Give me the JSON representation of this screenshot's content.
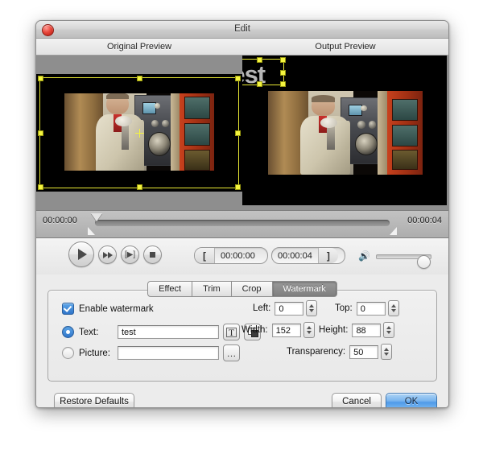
{
  "window": {
    "title": "Edit",
    "close_icon": "close-icon"
  },
  "previews": {
    "original_label": "Original Preview",
    "output_label": "Output Preview",
    "watermark_overlay_text": "test"
  },
  "timeline": {
    "start_time": "00:00:00",
    "end_time": "00:00:04"
  },
  "transport": {
    "play_icon": "play-icon",
    "forward_icon": "fast-forward-icon",
    "step_icon": "step-frame-icon",
    "stop_icon": "stop-icon",
    "in_bracket": "[",
    "in_time": "00:00:00",
    "out_time": "00:00:04",
    "out_bracket": "]",
    "volume_icon": "speaker-icon"
  },
  "tabs": [
    {
      "label": "Effect",
      "active": false
    },
    {
      "label": "Trim",
      "active": false
    },
    {
      "label": "Crop",
      "active": false
    },
    {
      "label": "Watermark",
      "active": true
    }
  ],
  "watermark_panel": {
    "enable_label": "Enable watermark",
    "enable_checked": true,
    "text_radio_label": "Text:",
    "text_value": "test",
    "text_placeholder": "",
    "font_button_glyph": "T",
    "color_button_icon": "color-swatch-icon",
    "picture_radio_label": "Picture:",
    "picture_value": "",
    "picture_placeholder": "",
    "browse_button_label": "…",
    "left_label": "Left:",
    "left_value": "0",
    "top_label": "Top:",
    "top_value": "0",
    "width_label": "Width:",
    "width_value": "152",
    "height_label": "Height:",
    "height_value": "88",
    "transparency_label": "Transparency:",
    "transparency_value": "50"
  },
  "footer": {
    "restore_label": "Restore Defaults",
    "cancel_label": "Cancel",
    "ok_label": "OK"
  },
  "colors": {
    "accent_blue": "#4f9ae8",
    "selection_yellow": "#e9e934",
    "tab_active": "#8a8a8a"
  }
}
